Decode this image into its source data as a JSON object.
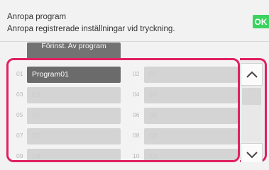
{
  "header": {
    "title": "Anropa program",
    "subtitle": "Anropa registrerade inställningar vid tryckning.",
    "ok_label": "OK"
  },
  "tab": {
    "label": "Förinst. Av program"
  },
  "programs": [
    {
      "num": "01",
      "label": "Program01",
      "filled": true
    },
    {
      "num": "02",
      "label": "02",
      "filled": false
    },
    {
      "num": "03",
      "label": "03",
      "filled": false
    },
    {
      "num": "04",
      "label": "04",
      "filled": false
    },
    {
      "num": "05",
      "label": "05",
      "filled": false
    },
    {
      "num": "06",
      "label": "06",
      "filled": false
    },
    {
      "num": "07",
      "label": "07",
      "filled": false
    },
    {
      "num": "08",
      "label": "08",
      "filled": false
    },
    {
      "num": "09",
      "label": "09",
      "filled": false
    },
    {
      "num": "10",
      "label": "10",
      "filled": false
    }
  ],
  "scroll": {
    "up_icon": "chevron-up-icon",
    "down_icon": "chevron-down-icon",
    "position": 0
  },
  "colors": {
    "ok_green": "#39d35e",
    "highlight_frame": "#e0205f",
    "filled_slot": "#6b6b6b",
    "empty_slot": "#d4d4d4"
  }
}
